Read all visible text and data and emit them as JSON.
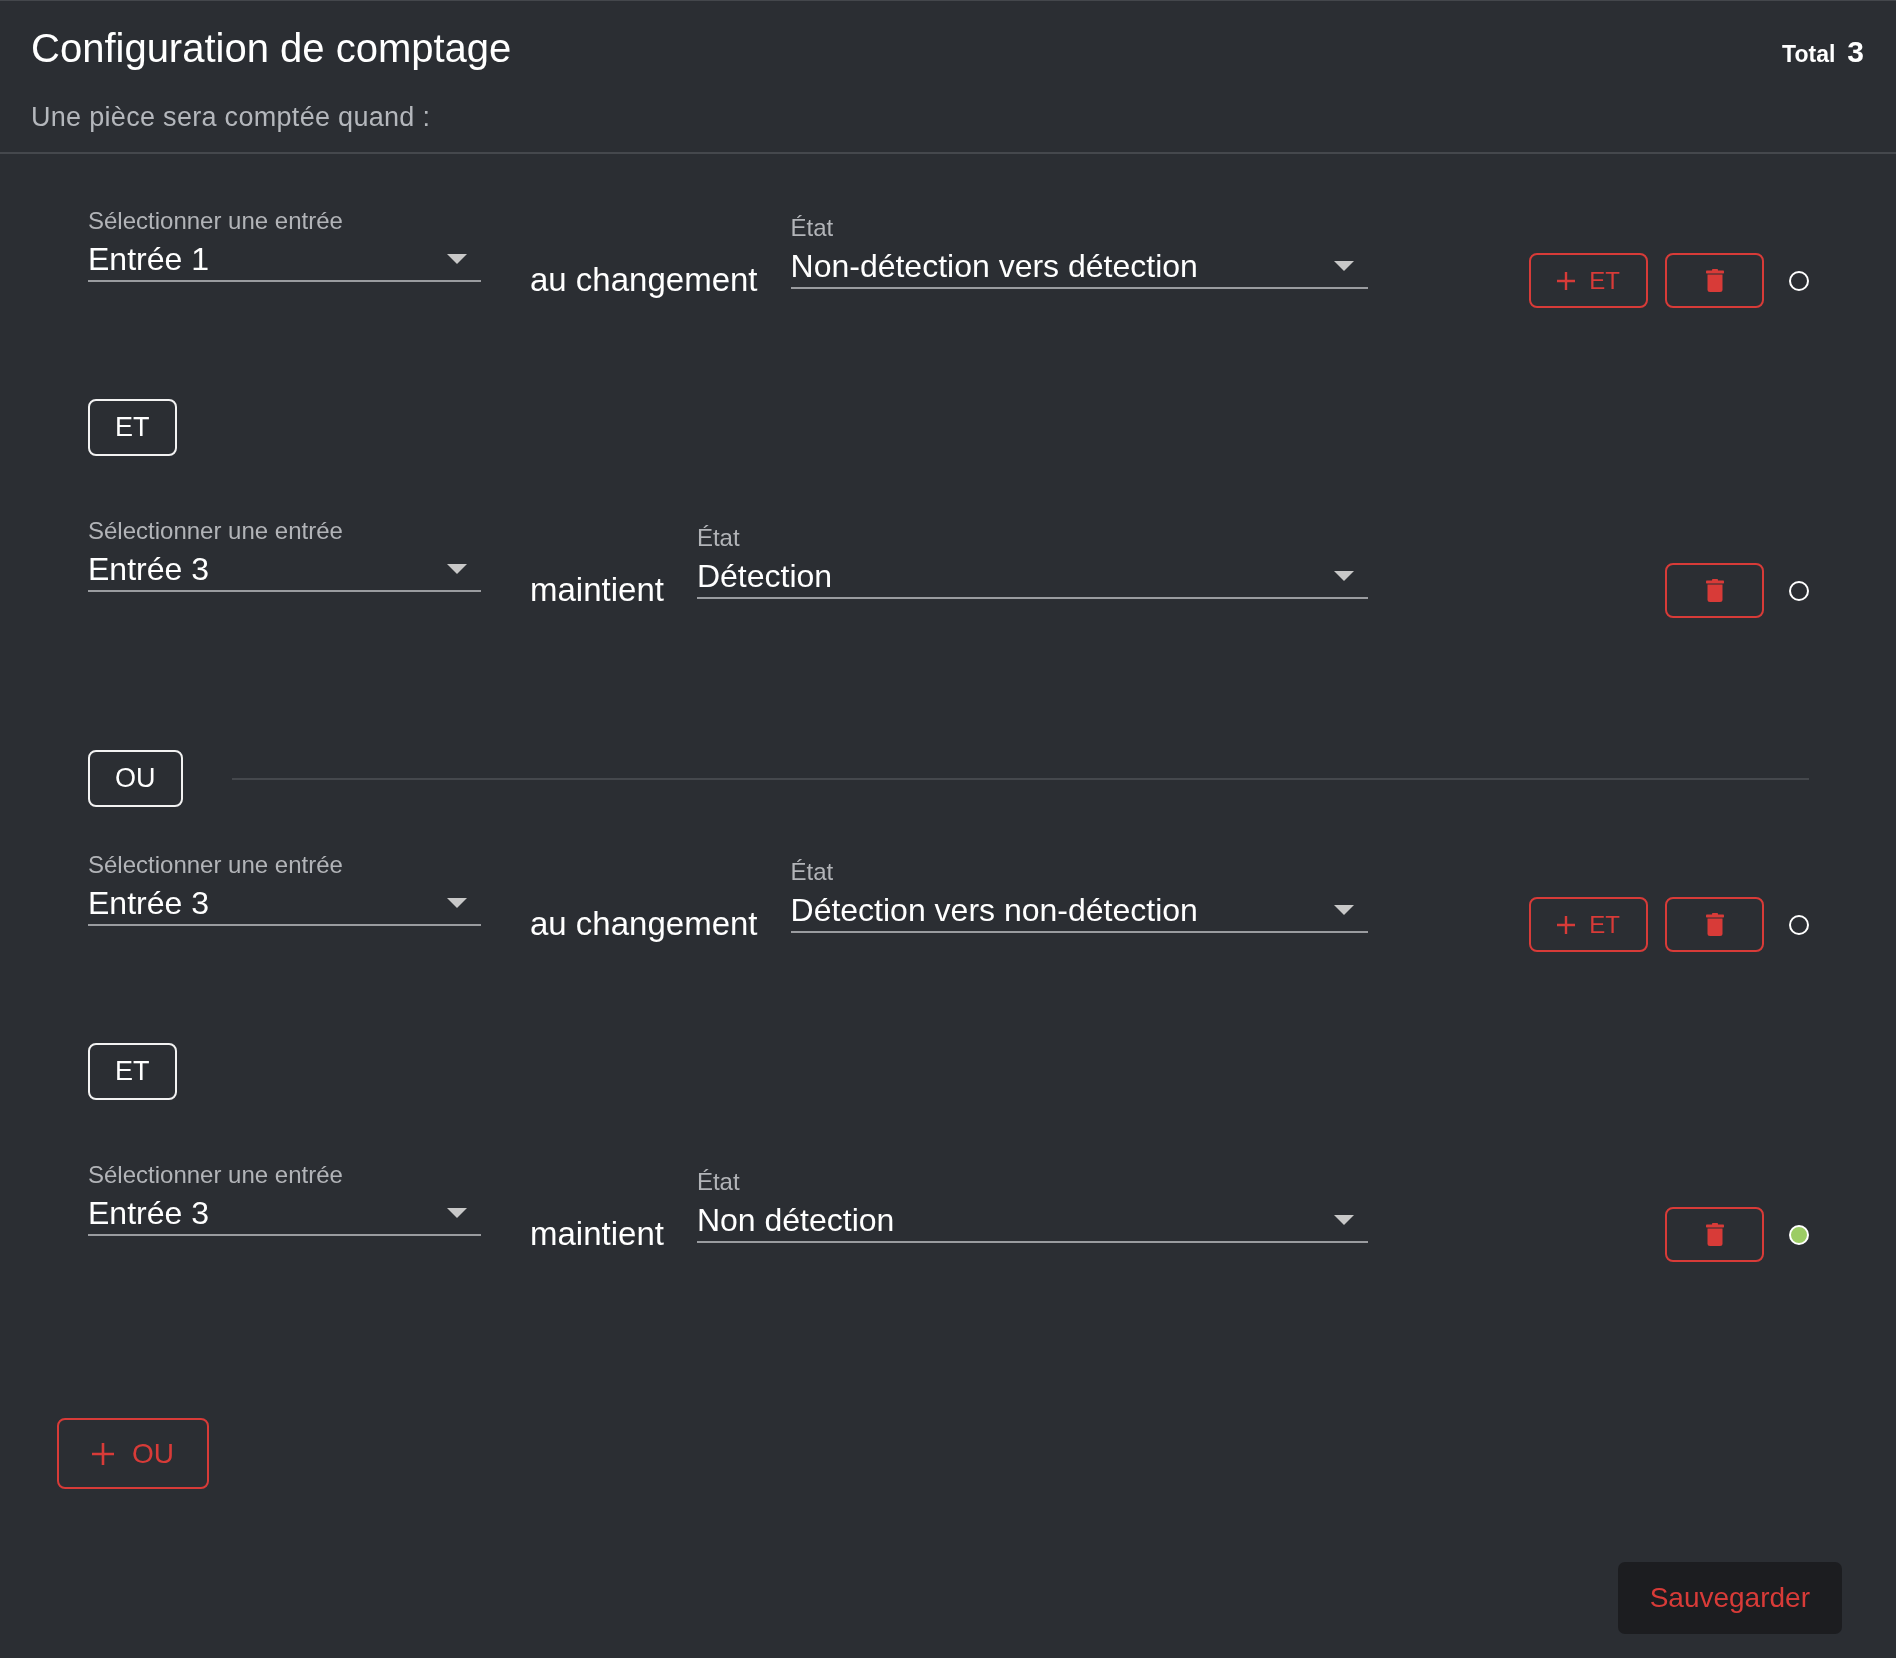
{
  "header": {
    "title": "Configuration de comptage",
    "subtitle": "Une pièce sera comptée quand :",
    "total_label": "Total",
    "total_value": "3"
  },
  "groups": [
    {
      "conditions": [
        {
          "input_label": "Sélectionner une entrée",
          "input_value": "Entrée 1",
          "verb": "au changement",
          "state_label": "État",
          "state_value": "Non-détection vers détection",
          "add_button": "ET",
          "active": false
        },
        {
          "joiner": "ET",
          "input_label": "Sélectionner une entrée",
          "input_value": "Entrée 3",
          "verb": "maintient",
          "state_label": "État",
          "state_value": "Détection",
          "active": false
        }
      ]
    },
    {
      "separator": "OU",
      "conditions": [
        {
          "input_label": "Sélectionner une entrée",
          "input_value": "Entrée 3",
          "verb": "au changement",
          "state_label": "État",
          "state_value": "Détection vers non-détection",
          "add_button": "ET",
          "active": false
        },
        {
          "joiner": "ET",
          "input_label": "Sélectionner une entrée",
          "input_value": "Entrée 3",
          "verb": "maintient",
          "state_label": "État",
          "state_value": "Non détection",
          "active": true
        }
      ]
    }
  ],
  "add_group_button": "OU",
  "save_button": "Sauvegarder"
}
